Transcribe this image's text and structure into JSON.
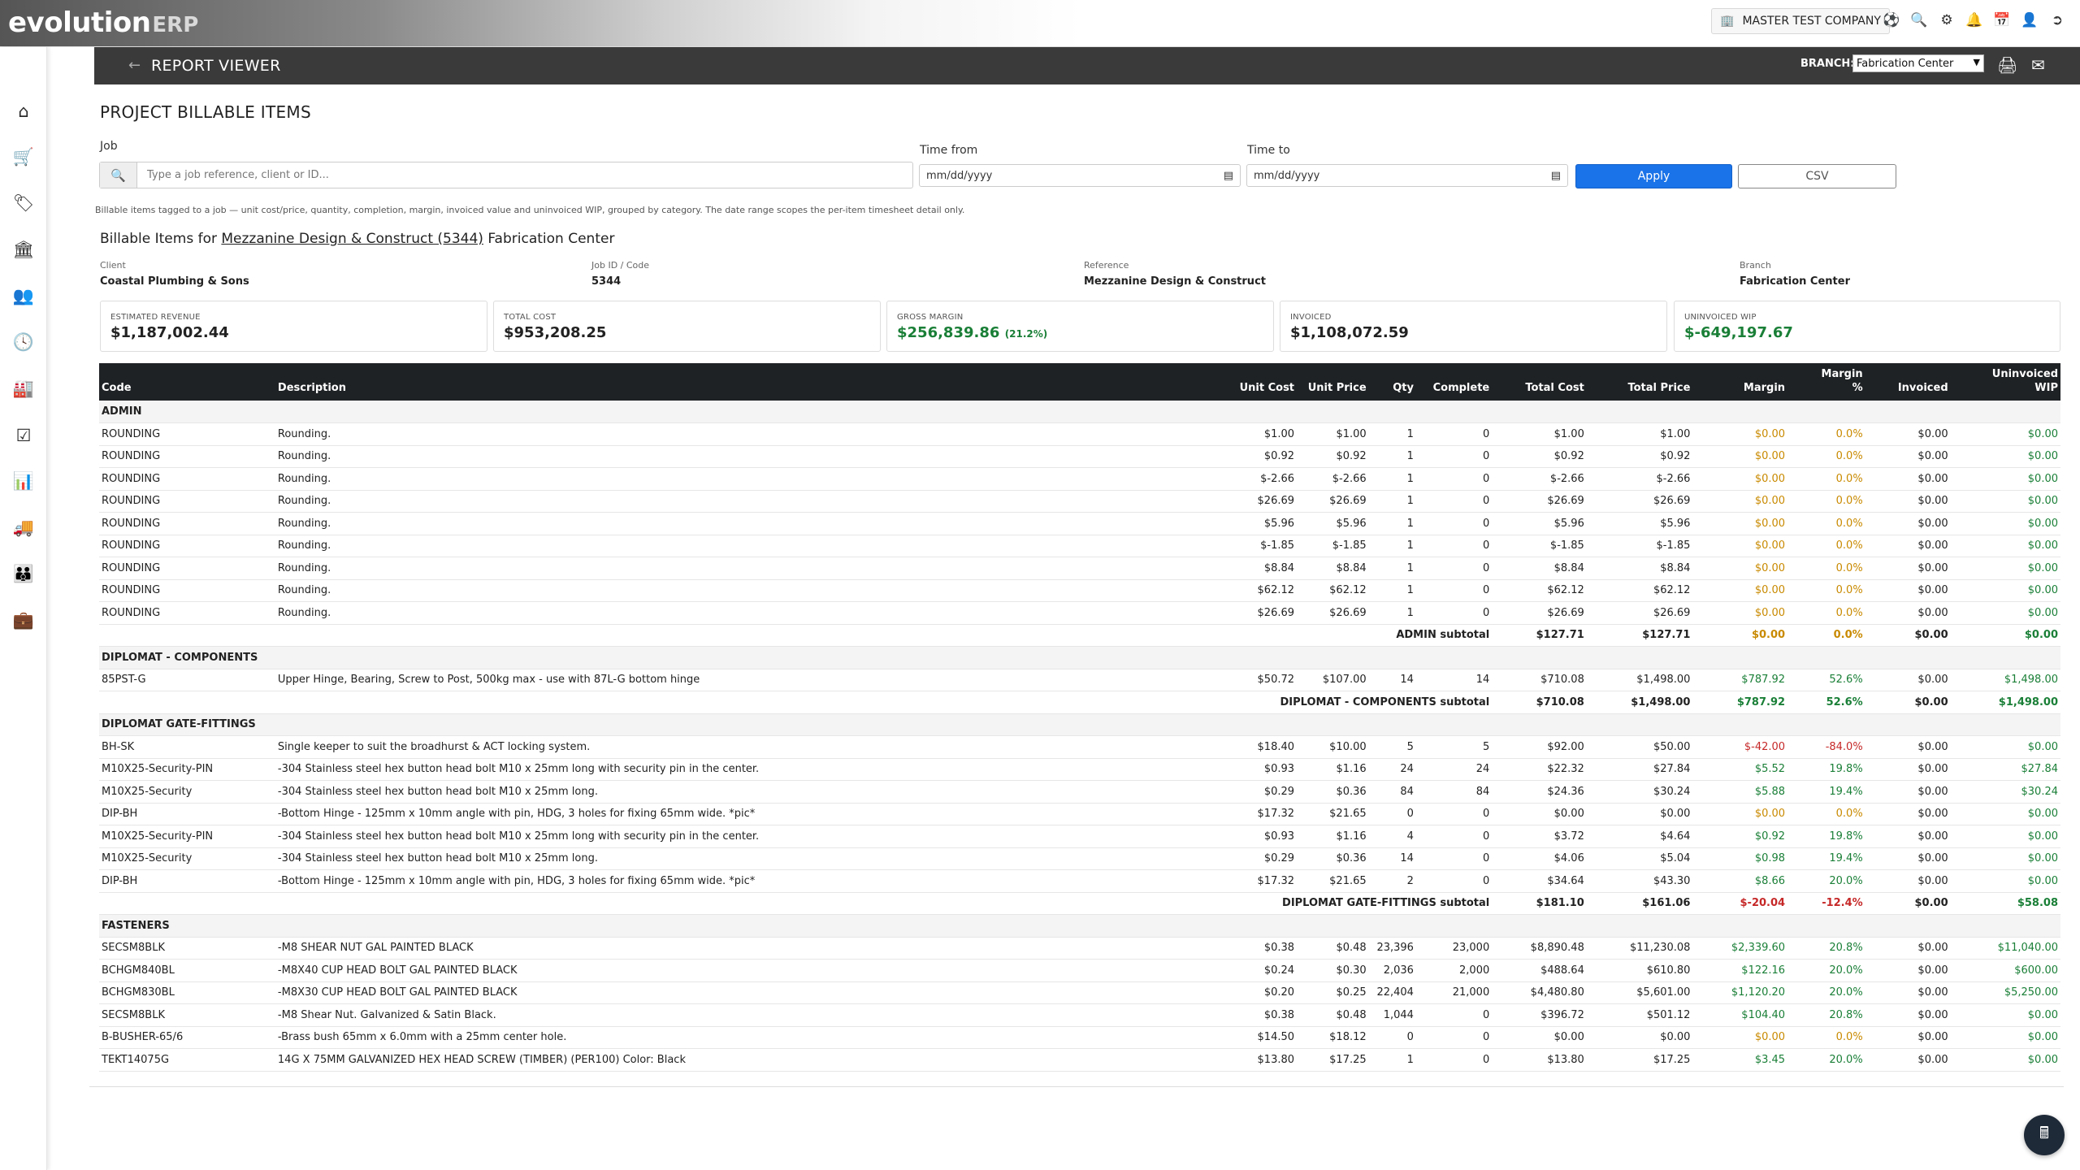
{
  "brand": {
    "logo_main": "evolution",
    "logo_suffix": "ERP"
  },
  "topbar": {
    "company": "MASTER TEST COMPANY",
    "icons": [
      "building-icon",
      "support-icon",
      "search-icon",
      "extensions-icon",
      "bell-icon",
      "calendar-icon",
      "user-icon",
      "logout-icon"
    ]
  },
  "sidebar": {
    "items": [
      "home",
      "cart",
      "tags",
      "bank",
      "contacts",
      "clock",
      "factory",
      "checklist",
      "chart",
      "vehicles",
      "users",
      "toolbox"
    ]
  },
  "header": {
    "title": "REPORT VIEWER",
    "branch_label": "BRANCH:",
    "branch_value": "Fabrication Center"
  },
  "page": {
    "title": "PROJECT BILLABLE ITEMS"
  },
  "filters": {
    "job_label": "Job",
    "job_placeholder": "Type a job reference, client or ID...",
    "time_from_label": "Time from",
    "time_from_value": "mm/dd/yyyy",
    "time_to_label": "Time to",
    "time_to_value": "mm/dd/yyyy",
    "apply": "Apply",
    "csv": "CSV"
  },
  "help": "Billable items tagged to a job — unit cost/price, quantity, completion, margin, invoiced value and uninvoiced WIP, grouped by category. The date range scopes the per-item timesheet detail only.",
  "billable": {
    "prefix": "Billable Items for ",
    "job_link": "Mezzanine Design & Construct (5344)",
    "suffix": " Fabrication Center"
  },
  "info": [
    {
      "key": "Client",
      "value": "Coastal Plumbing & Sons"
    },
    {
      "key": "Job ID / Code",
      "value": "5344"
    },
    {
      "key": "Reference",
      "value": "Mezzanine Design & Construct"
    },
    {
      "key": "Branch",
      "value": "Fabrication Center"
    }
  ],
  "kpis": [
    {
      "key": "ESTIMATED REVENUE",
      "value": "$1,187,002.44"
    },
    {
      "key": "TOTAL COST",
      "value": "$953,208.25"
    },
    {
      "key": "GROSS MARGIN",
      "value": "$256,839.86",
      "pct": "(21.2%)"
    },
    {
      "key": "INVOICED",
      "value": "$1,108,072.59"
    },
    {
      "key": "UNINVOICED WIP",
      "value": "$-649,197.67"
    }
  ],
  "columns": [
    "Code",
    "Description",
    "Unit Cost",
    "Unit Price",
    "Qty",
    "Complete",
    "Total Cost",
    "Total Price",
    "Margin",
    "Margin %",
    "Invoiced",
    "Uninvoiced WIP"
  ],
  "groups": [
    {
      "name": "ADMIN",
      "rows": [
        [
          "ROUNDING",
          "Rounding.",
          "$1.00",
          "$1.00",
          "1",
          "0",
          "$1.00",
          "$1.00",
          "$0.00",
          "0.0%",
          "$0.00",
          "$0.00"
        ],
        [
          "ROUNDING",
          "Rounding.",
          "$0.92",
          "$0.92",
          "1",
          "0",
          "$0.92",
          "$0.92",
          "$0.00",
          "0.0%",
          "$0.00",
          "$0.00"
        ],
        [
          "ROUNDING",
          "Rounding.",
          "$-2.66",
          "$-2.66",
          "1",
          "0",
          "$-2.66",
          "$-2.66",
          "$0.00",
          "0.0%",
          "$0.00",
          "$0.00"
        ],
        [
          "ROUNDING",
          "Rounding.",
          "$26.69",
          "$26.69",
          "1",
          "0",
          "$26.69",
          "$26.69",
          "$0.00",
          "0.0%",
          "$0.00",
          "$0.00"
        ],
        [
          "ROUNDING",
          "Rounding.",
          "$5.96",
          "$5.96",
          "1",
          "0",
          "$5.96",
          "$5.96",
          "$0.00",
          "0.0%",
          "$0.00",
          "$0.00"
        ],
        [
          "ROUNDING",
          "Rounding.",
          "$-1.85",
          "$-1.85",
          "1",
          "0",
          "$-1.85",
          "$-1.85",
          "$0.00",
          "0.0%",
          "$0.00",
          "$0.00"
        ],
        [
          "ROUNDING",
          "Rounding.",
          "$8.84",
          "$8.84",
          "1",
          "0",
          "$8.84",
          "$8.84",
          "$0.00",
          "0.0%",
          "$0.00",
          "$0.00"
        ],
        [
          "ROUNDING",
          "Rounding.",
          "$62.12",
          "$62.12",
          "1",
          "0",
          "$62.12",
          "$62.12",
          "$0.00",
          "0.0%",
          "$0.00",
          "$0.00"
        ],
        [
          "ROUNDING",
          "Rounding.",
          "$26.69",
          "$26.69",
          "1",
          "0",
          "$26.69",
          "$26.69",
          "$0.00",
          "0.0%",
          "$0.00",
          "$0.00"
        ]
      ],
      "subtotal": [
        "ADMIN subtotal",
        "$127.71",
        "$127.71",
        "$0.00",
        "0.0%",
        "$0.00",
        "$0.00"
      ]
    },
    {
      "name": "DIPLOMAT - COMPONENTS",
      "rows": [
        [
          "85PST-G",
          "Upper Hinge, Bearing, Screw to Post, 500kg max - use with 87L-G bottom hinge",
          "$50.72",
          "$107.00",
          "14",
          "14",
          "$710.08",
          "$1,498.00",
          "$787.92",
          "52.6%",
          "$0.00",
          "$1,498.00"
        ]
      ],
      "subtotal": [
        "DIPLOMAT - COMPONENTS subtotal",
        "$710.08",
        "$1,498.00",
        "$787.92",
        "52.6%",
        "$0.00",
        "$1,498.00"
      ]
    },
    {
      "name": "DIPLOMAT GATE-FITTINGS",
      "rows": [
        [
          "BH-SK",
          "Single keeper to suit the broadhurst & ACT locking system.",
          "$18.40",
          "$10.00",
          "5",
          "5",
          "$92.00",
          "$50.00",
          "$-42.00",
          "-84.0%",
          "$0.00",
          "$0.00"
        ],
        [
          "M10X25-Security-PIN",
          "-304 Stainless steel hex button head bolt M10 x 25mm long with security pin in the center.",
          "$0.93",
          "$1.16",
          "24",
          "24",
          "$22.32",
          "$27.84",
          "$5.52",
          "19.8%",
          "$0.00",
          "$27.84"
        ],
        [
          "M10X25-Security",
          "-304 Stainless steel hex button head bolt M10 x 25mm long.",
          "$0.29",
          "$0.36",
          "84",
          "84",
          "$24.36",
          "$30.24",
          "$5.88",
          "19.4%",
          "$0.00",
          "$30.24"
        ],
        [
          "DIP-BH",
          "-Bottom Hinge - 125mm x 10mm angle with pin, HDG, 3 holes for fixing 65mm wide. *pic*",
          "$17.32",
          "$21.65",
          "0",
          "0",
          "$0.00",
          "$0.00",
          "$0.00",
          "0.0%",
          "$0.00",
          "$0.00"
        ],
        [
          "M10X25-Security-PIN",
          "-304 Stainless steel hex button head bolt M10 x 25mm long with security pin in the center.",
          "$0.93",
          "$1.16",
          "4",
          "0",
          "$3.72",
          "$4.64",
          "$0.92",
          "19.8%",
          "$0.00",
          "$0.00"
        ],
        [
          "M10X25-Security",
          "-304 Stainless steel hex button head bolt M10 x 25mm long.",
          "$0.29",
          "$0.36",
          "14",
          "0",
          "$4.06",
          "$5.04",
          "$0.98",
          "19.4%",
          "$0.00",
          "$0.00"
        ],
        [
          "DIP-BH",
          "-Bottom Hinge - 125mm x 10mm angle with pin, HDG, 3 holes for fixing 65mm wide. *pic*",
          "$17.32",
          "$21.65",
          "2",
          "0",
          "$34.64",
          "$43.30",
          "$8.66",
          "20.0%",
          "$0.00",
          "$0.00"
        ]
      ],
      "subtotal": [
        "DIPLOMAT GATE-FITTINGS subtotal",
        "$181.10",
        "$161.06",
        "$-20.04",
        "-12.4%",
        "$0.00",
        "$58.08"
      ]
    },
    {
      "name": "FASTENERS",
      "rows": [
        [
          "SECSM8BLK",
          "-M8 SHEAR NUT GAL PAINTED BLACK",
          "$0.38",
          "$0.48",
          "23,396",
          "23,000",
          "$8,890.48",
          "$11,230.08",
          "$2,339.60",
          "20.8%",
          "$0.00",
          "$11,040.00"
        ],
        [
          "BCHGM840BL",
          "-M8X40 CUP HEAD BOLT GAL PAINTED BLACK",
          "$0.24",
          "$0.30",
          "2,036",
          "2,000",
          "$488.64",
          "$610.80",
          "$122.16",
          "20.0%",
          "$0.00",
          "$600.00"
        ],
        [
          "BCHGM830BL",
          "-M8X30 CUP HEAD BOLT GAL PAINTED BLACK",
          "$0.20",
          "$0.25",
          "22,404",
          "21,000",
          "$4,480.80",
          "$5,601.00",
          "$1,120.20",
          "20.0%",
          "$0.00",
          "$5,250.00"
        ],
        [
          "SECSM8BLK",
          "-M8 Shear Nut. Galvanized & Satin Black.",
          "$0.38",
          "$0.48",
          "1,044",
          "0",
          "$396.72",
          "$501.12",
          "$104.40",
          "20.8%",
          "$0.00",
          "$0.00"
        ],
        [
          "B-BUSHER-65/6",
          "-Brass bush 65mm x 6.0mm with a 25mm center hole.",
          "$14.50",
          "$18.12",
          "0",
          "0",
          "$0.00",
          "$0.00",
          "$0.00",
          "0.0%",
          "$0.00",
          "$0.00"
        ],
        [
          "TEKT14075G",
          "14G X 75MM GALVANIZED HEX HEAD SCREW (TIMBER) (PER100) Color: Black",
          "$13.80",
          "$17.25",
          "1",
          "0",
          "$13.80",
          "$17.25",
          "$3.45",
          "20.0%",
          "$0.00",
          "$0.00"
        ]
      ],
      "subtotal": null
    }
  ],
  "colors": {
    "accent": "#1a73e8",
    "positive": "#1a7f37",
    "negative": "#c62828",
    "neutral_margin": "#c98a00",
    "header_bg": "#3a3a3a",
    "table_head_bg": "#1f2225"
  }
}
